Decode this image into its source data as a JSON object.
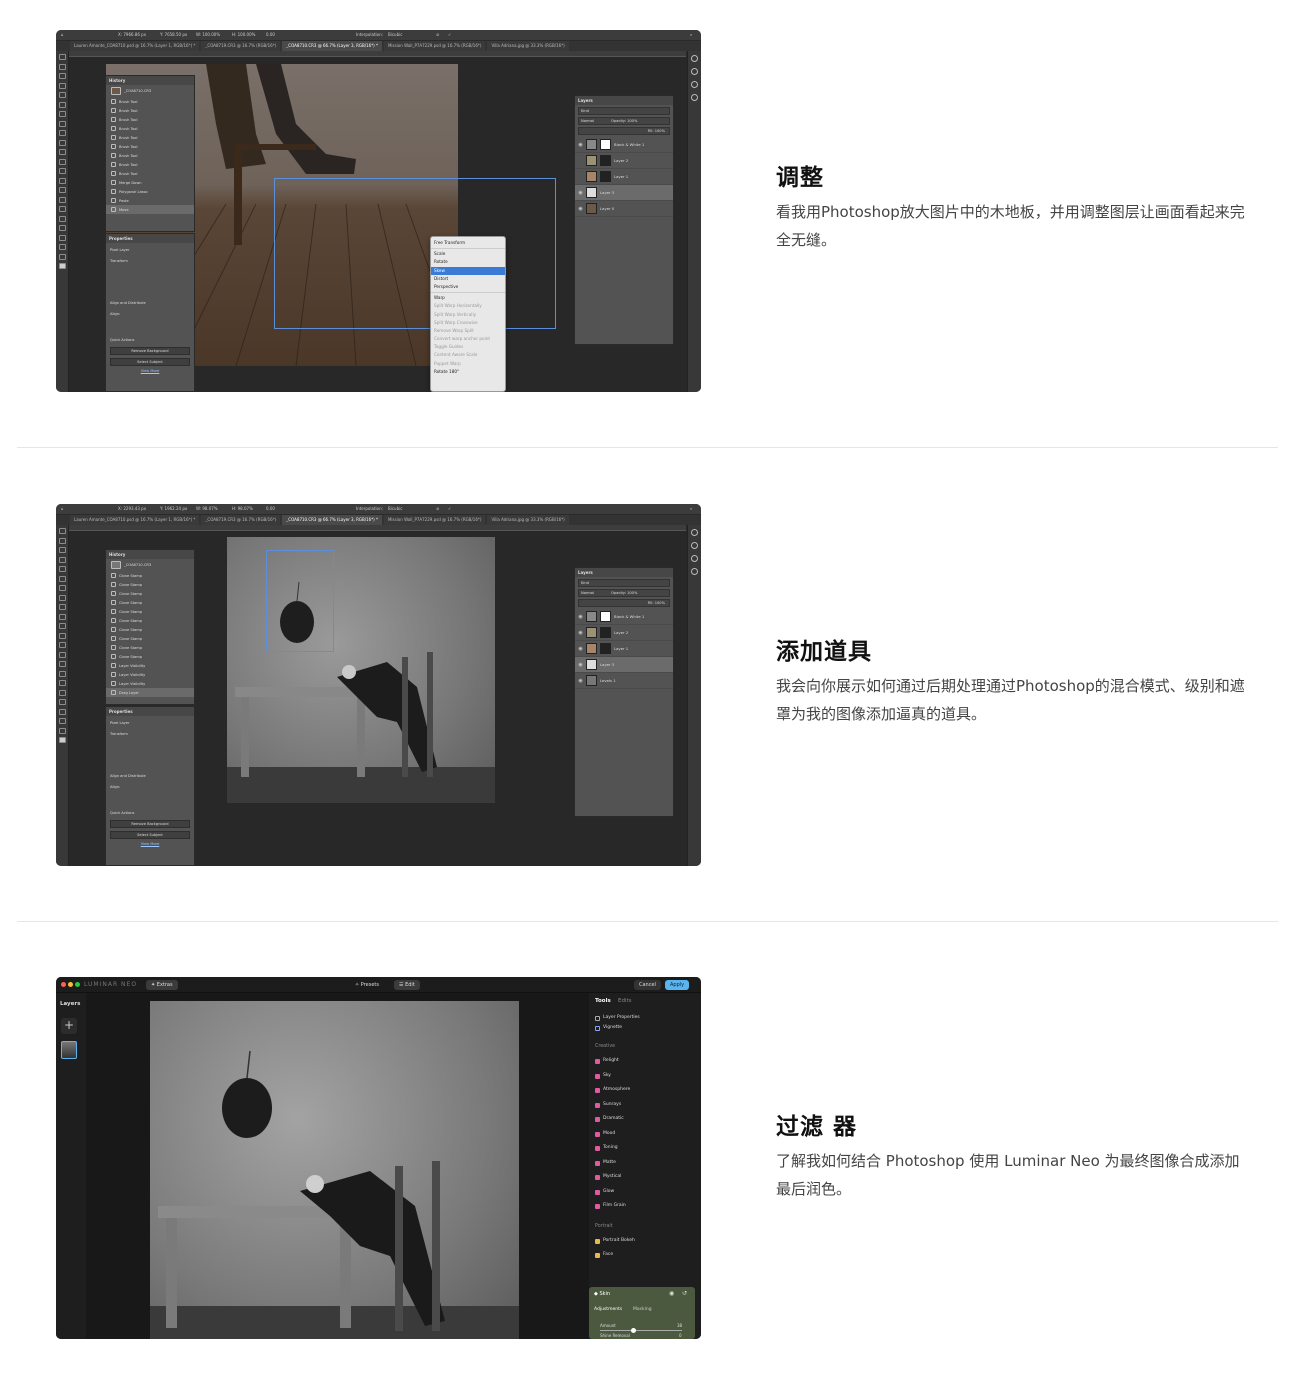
{
  "sections": [
    {
      "title": "调整",
      "body": "看我用Photoshop放大图片中的木地板，并用调整图层让画面看起来完全无缝。"
    },
    {
      "title": "添加道具",
      "body": "我会向你展示如何通过后期处理通过Photoshop的混合模式、级别和遮罩为我的图像添加逼真的道具。"
    },
    {
      "title": "过滤 器",
      "body": "了解我如何结合 Photoshop 使用 Luminar Neo 为最终图像合成添加最后润色。"
    }
  ],
  "ps1": {
    "tabs": [
      "Lauren Amante_COA8710.psd @ 16.7% (Layer 1, RGB/16*) *",
      "_COA8719.CR3 @ 16.7% (RGB/16*)",
      "_COA8710.CR3 @ 66.7% (Layer 3, RGB/16*) *",
      "Mission Wall_P7A7229.psd @ 16.7% (RGB/16*)",
      "Villa Adriana.jpg @ 33.3% (RGB/16*)"
    ],
    "options": {
      "x": "X: 7966.86 px",
      "y": "Y: 7658.50 px",
      "w": "W: 100.00%",
      "h": "H: 100.00%",
      "angle": "0.00",
      "interp_label": "Interpolation:",
      "interp_value": "Bicubic"
    },
    "history": {
      "title": "History",
      "source": "_COA8710.CR3",
      "items": [
        "Brush Tool",
        "Brush Tool",
        "Brush Tool",
        "Brush Tool",
        "Brush Tool",
        "Brush Tool",
        "Brush Tool",
        "Brush Tool",
        "Brush Tool",
        "Merge Down",
        "Polygonal Lasso",
        "Paste",
        "Move"
      ]
    },
    "properties": {
      "title": "Properties",
      "pixel_layer": "Pixel Layer",
      "transform": "Transform",
      "align": "Align and Distribute",
      "align_sub": "Align:",
      "quick": "Quick Actions",
      "remove_bg": "Remove Background",
      "select_subject": "Select Subject",
      "view_more": "View More"
    },
    "layers": {
      "title": "Layers",
      "kind": "Kind",
      "mode": "Normal",
      "opacity": "Opacity: 100%",
      "fill": "Fill: 100%",
      "rows": [
        "Black & White 1",
        "Layer 2",
        "Layer 1",
        "Layer 3",
        "Layer 0"
      ]
    },
    "menu": [
      "Free Transform",
      "Scale",
      "Rotate",
      "Skew",
      "Distort",
      "Perspective",
      "Warp",
      "Split Warp Horizontally",
      "Split Warp Vertically",
      "Split Warp Crosswise",
      "Remove Warp Split",
      "Convert warp anchor point",
      "Toggle Guides",
      "Content Aware Scale",
      "Puppet Warp",
      "Rotate 180°"
    ]
  },
  "ps2": {
    "tabs": [
      "Lauren Amante_COA8710.psd @ 16.7% (Layer 1, RGB/16*) *",
      "_COA8719.CR3 @ 16.7% (RGB/16*)",
      "_COA8710.CR3 @ 66.7% (Layer 3, RGB/16*) *",
      "Mission Wall_P7A7229.psd @ 16.7% (RGB/16*)",
      "Villa Adriana.jpg @ 33.3% (RGB/16*)"
    ],
    "options": {
      "x": "X: 2293.43 px",
      "y": "Y: 1962.24 px",
      "w": "W: 98.07%",
      "h": "H: 98.07%",
      "angle": "0.00",
      "interp_label": "Interpolation:",
      "interp_value": "Bicubic"
    },
    "history": {
      "title": "History",
      "source": "_COA8710.CR3",
      "items": [
        "Clone Stamp",
        "Clone Stamp",
        "Clone Stamp",
        "Clone Stamp",
        "Clone Stamp",
        "Clone Stamp",
        "Clone Stamp",
        "Clone Stamp",
        "Clone Stamp",
        "Clone Stamp",
        "Layer Visibility",
        "Layer Visibility",
        "Layer Visibility",
        "Drag Layer"
      ]
    },
    "properties": {
      "title": "Properties",
      "pixel_layer": "Pixel Layer",
      "transform": "Transform",
      "align": "Align and Distribute",
      "align_sub": "Align:",
      "quick": "Quick Actions",
      "remove_bg": "Remove Background",
      "select_subject": "Select Subject",
      "view_more": "View More"
    },
    "layers": {
      "title": "Layers",
      "kind": "Kind",
      "mode": "Normal",
      "opacity": "Opacity: 100%",
      "fill": "Fill: 100%",
      "rows": [
        "Black & White 1",
        "Layer 2",
        "Layer 1",
        "Layer 3",
        "Levels 1"
      ]
    }
  },
  "lum": {
    "logo": "LUMINAR NEO",
    "extras": "Extras",
    "presets": "Presets",
    "edit": "Edit",
    "cancel": "Cancel",
    "apply": "Apply",
    "layers_title": "Layers",
    "tools_tab": "Tools",
    "edits_tab": "Edits",
    "essentials": [
      "Layer Properties",
      "Vignette"
    ],
    "creative_title": "Creative",
    "creative": [
      "Relight",
      "Sky",
      "Atmosphere",
      "Sunrays",
      "Dramatic",
      "Mood",
      "Toning",
      "Matte",
      "Mystical",
      "Glow",
      "Film Grain"
    ],
    "portrait_title": "Portrait",
    "portrait": [
      "Portrait Bokeh",
      "Face"
    ],
    "skin": "Skin",
    "adjustments": "Adjustments",
    "masking": "Masking",
    "amount": "Amount",
    "amount_value": "38",
    "shine": "Shine Removal",
    "shine_value": "0"
  },
  "colors": {
    "accent_blue": "#5ab4f0",
    "menu_highlight": "#3a7bd5",
    "skin_panel": "#4b5a3e"
  }
}
